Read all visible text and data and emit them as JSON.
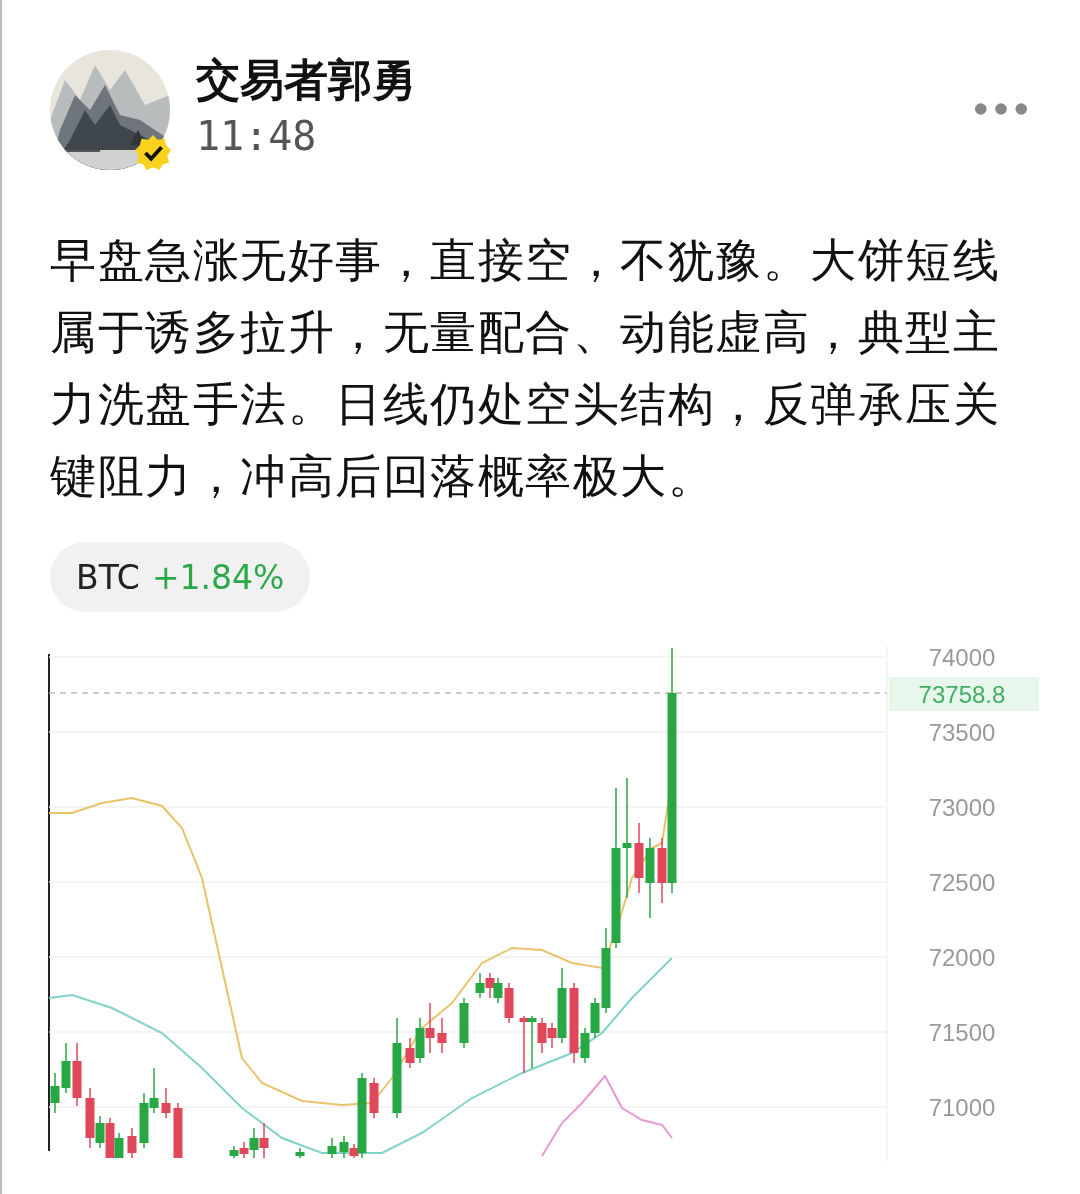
{
  "author": {
    "name": "交易者郭勇",
    "time": "11:48",
    "verified": true
  },
  "post": {
    "text": "早盘急涨无好事，直接空，不犹豫。大饼短线属于诱多拉升，无量配合、动能虚高，典型主力洗盘手法。日线仍处空头结构，反弹承压关键阻力，冲高后回落概率极大。"
  },
  "ticker": {
    "symbol": "BTC",
    "change": "+1.84%"
  },
  "chart": {
    "last_price": "73758.8",
    "axis_labels": [
      "74000",
      "73500",
      "73000",
      "72500",
      "72000",
      "71500",
      "71000"
    ]
  }
}
